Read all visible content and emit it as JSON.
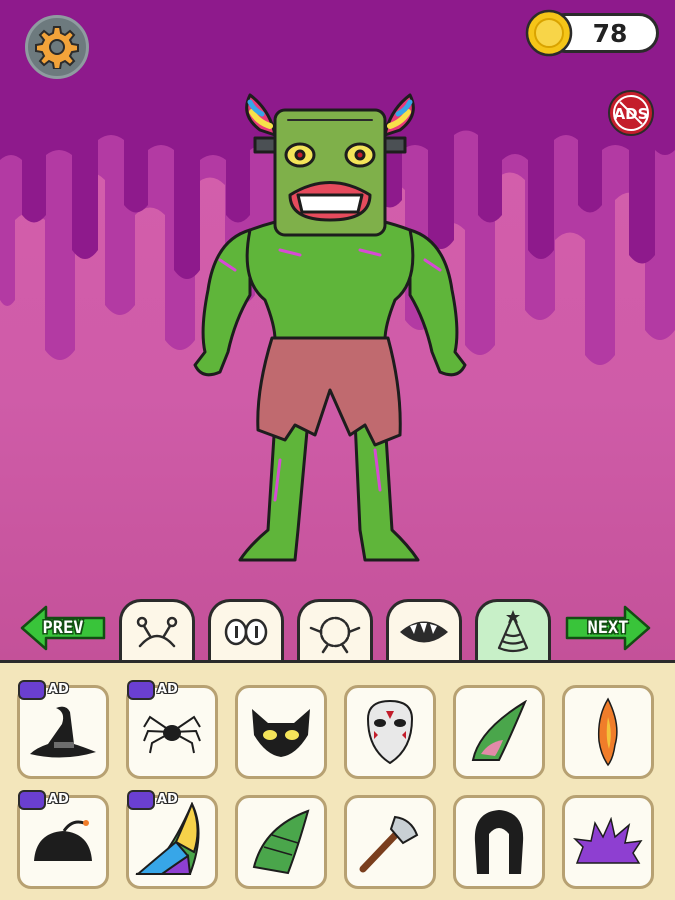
{
  "hud": {
    "coins": "78",
    "ads_label": "ADS"
  },
  "nav": {
    "prev_label": "PREV",
    "next_label": "NEXT"
  },
  "tabs": [
    {
      "icon": "antenna-icon",
      "active": false
    },
    {
      "icon": "eyes-icon",
      "active": false
    },
    {
      "icon": "fur-body-icon",
      "active": false
    },
    {
      "icon": "mouth-icon",
      "active": false
    },
    {
      "icon": "party-hat-icon",
      "active": true
    }
  ],
  "items": [
    {
      "icon": "witch-hat-icon",
      "ad": true
    },
    {
      "icon": "spider-icon",
      "ad": true
    },
    {
      "icon": "cat-mask-icon",
      "ad": false
    },
    {
      "icon": "hockey-mask-icon",
      "ad": false
    },
    {
      "icon": "green-horn-icon",
      "ad": false
    },
    {
      "icon": "flame-icon",
      "ad": false
    },
    {
      "icon": "bomb-hat-icon",
      "ad": true
    },
    {
      "icon": "rainbow-horn-icon",
      "ad": true
    },
    {
      "icon": "green-curved-horn-icon",
      "ad": false
    },
    {
      "icon": "axe-icon",
      "ad": false
    },
    {
      "icon": "black-hair-icon",
      "ad": false
    },
    {
      "icon": "purple-spikes-icon",
      "ad": false
    }
  ],
  "ad_badge_label": "AD",
  "colors": {
    "sky_top": "#8e1a8c",
    "sky_bottom": "#d65fae",
    "skin": "#5fb53a",
    "shorts": "#c06a6f",
    "tray": "#f3e6bb",
    "nav_green": "#39c43a"
  }
}
